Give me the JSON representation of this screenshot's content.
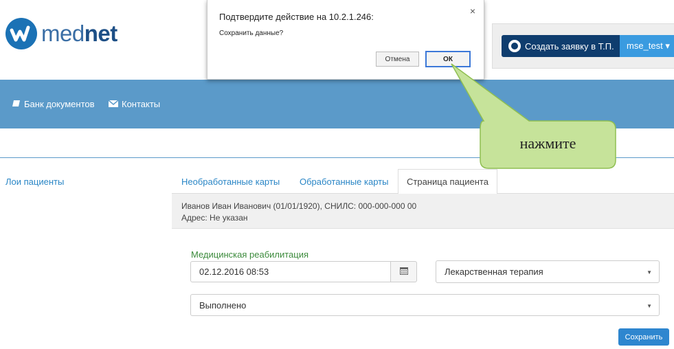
{
  "header": {
    "logo_text_light": "med",
    "logo_text_bold": "net",
    "ticket_button_label": "Создать заявку в Т.П.",
    "user_button_label": "mse_test ▾"
  },
  "navbar": {
    "items": [
      {
        "label": "Банк документов",
        "icon": "book-icon"
      },
      {
        "label": "Контакты",
        "icon": "envelope-icon"
      }
    ]
  },
  "sidebar": {
    "my_patients_label": "Лои пациенты"
  },
  "tabs": [
    {
      "label": "Необработанные карты",
      "active": false
    },
    {
      "label": "Обработанные карты",
      "active": false
    },
    {
      "label": "Страница пациента",
      "active": true
    }
  ],
  "patient": {
    "info_line": "Иванов Иван Иванович (01/01/1920), СНИЛС: 000-000-000 00",
    "address_line": "Адрес: Не указан"
  },
  "form": {
    "section_label": "Медицинская реабилитация",
    "date_value": "02.12.2016 08:53",
    "therapy_select_value": "Лекарственная терапия",
    "status_select_value": "Выполнено",
    "save_label": "Сохранить"
  },
  "dialog": {
    "title": "Подтвердите действие на 10.2.1.246:",
    "message": "Сохранить данные?",
    "cancel_label": "Отмена",
    "ok_label": "ОК",
    "close_symbol": "×"
  },
  "callout": {
    "text": "нажмите",
    "fill_color": "#c6e39a",
    "border_color": "#8fbf52"
  },
  "colors": {
    "navbar": "#5b9ac9",
    "ticket_button": "#0f3d6e",
    "user_button": "#3a9be0",
    "save_button": "#2e86cf",
    "link": "#2a86c6",
    "section_label": "#3b8a3b"
  }
}
